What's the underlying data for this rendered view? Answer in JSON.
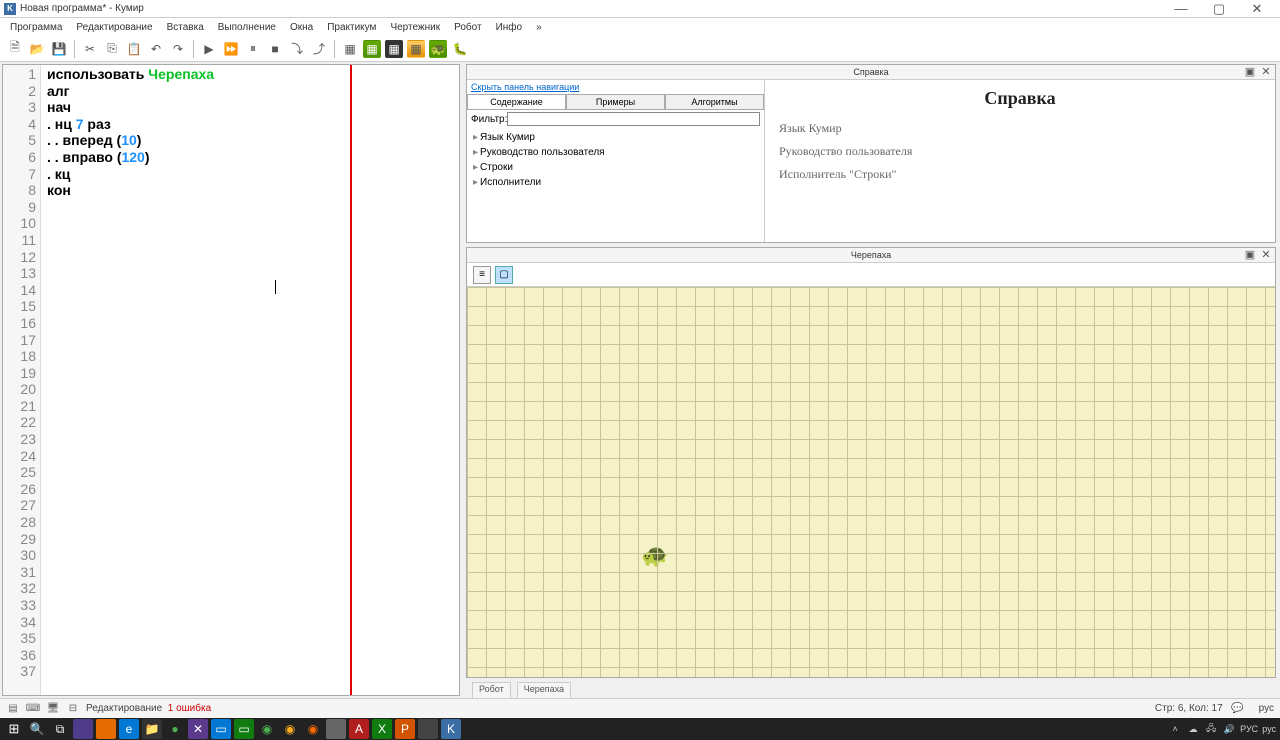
{
  "title": "Новая программа* - Кумир",
  "menu": [
    "Программа",
    "Редактирование",
    "Вставка",
    "Выполнение",
    "Окна",
    "Практикум",
    "Чертежник",
    "Робот",
    "Инфо",
    "»"
  ],
  "code": {
    "lines": [
      {
        "plain": "использовать ",
        "actor": "Черепаха"
      },
      {
        "plain": "алг"
      },
      {
        "plain": "нач"
      },
      {
        "plain": ". нц ",
        "num": "7",
        "after": " раз"
      },
      {
        "plain": ". . вперед (",
        "num": "10",
        "after": ")"
      },
      {
        "plain": ". . вправо (",
        "num": "120",
        "after": ")"
      },
      {
        "plain": ". кц"
      },
      {
        "plain": "кон"
      }
    ],
    "total_lines": 37
  },
  "help": {
    "panel_title": "Справка",
    "hide_link": "Скрыть панель навигации",
    "tabs": [
      "Содержание",
      "Примеры",
      "Алгоритмы"
    ],
    "filter_label": "Фильтр:",
    "tree": [
      "Язык Кумир",
      "Руководство пользователя",
      "Строки",
      "Исполнители"
    ],
    "heading": "Справка",
    "links": [
      "Язык Кумир",
      "Руководство пользователя",
      "Исполнитель \"Строки\""
    ]
  },
  "turtle": {
    "panel_title": "Черепаха"
  },
  "bottom_tabs": [
    "Робот",
    "Черепаха"
  ],
  "status": {
    "mode": "Редактирование",
    "errors": "1 ошибка",
    "pos": "Стр: 6, Кол: 17"
  },
  "tray": {
    "lang": "рус"
  }
}
